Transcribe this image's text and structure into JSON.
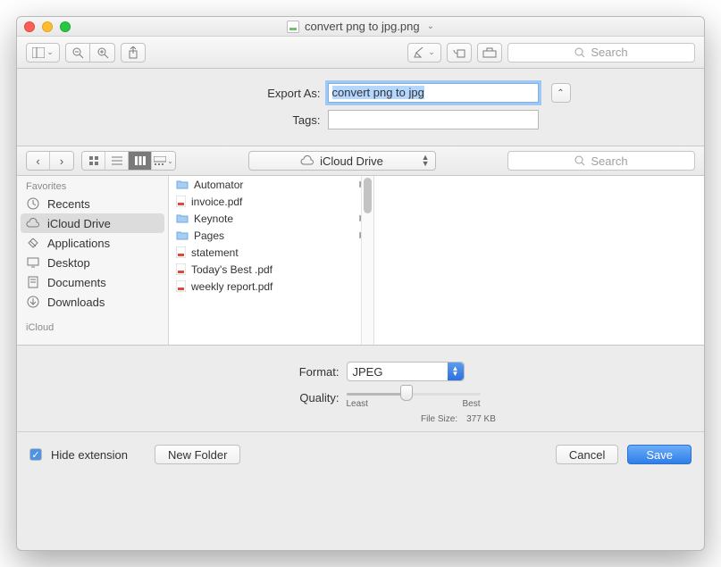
{
  "window": {
    "title": "convert png to jpg.png"
  },
  "toolbar": {
    "search_placeholder": "Search"
  },
  "export": {
    "export_as_label": "Export As:",
    "export_as_value": "convert png to jpg",
    "tags_label": "Tags:",
    "tags_value": ""
  },
  "browser": {
    "location": "iCloud Drive",
    "search_placeholder": "Search",
    "sidebar_header": "Favorites",
    "sidebar_secondary_header": "iCloud",
    "sidebar": [
      {
        "label": "Recents",
        "icon": "clock"
      },
      {
        "label": "iCloud Drive",
        "icon": "cloud",
        "selected": true
      },
      {
        "label": "Applications",
        "icon": "app"
      },
      {
        "label": "Desktop",
        "icon": "desktop"
      },
      {
        "label": "Documents",
        "icon": "doc"
      },
      {
        "label": "Downloads",
        "icon": "download"
      }
    ],
    "files": [
      {
        "name": "Automator",
        "kind": "folder",
        "has_children": true
      },
      {
        "name": "invoice.pdf",
        "kind": "pdf"
      },
      {
        "name": "Keynote",
        "kind": "folder",
        "has_children": true
      },
      {
        "name": "Pages",
        "kind": "folder",
        "has_children": true
      },
      {
        "name": "statement",
        "kind": "pdf"
      },
      {
        "name": "Today's Best .pdf",
        "kind": "pdf"
      },
      {
        "name": "weekly report.pdf",
        "kind": "pdf"
      }
    ]
  },
  "format": {
    "format_label": "Format:",
    "format_value": "JPEG",
    "quality_label": "Quality:",
    "quality_least": "Least",
    "quality_best": "Best",
    "filesize_label": "File Size:",
    "filesize_value": "377 KB"
  },
  "bottom": {
    "hide_ext_label": "Hide extension",
    "hide_ext_checked": true,
    "new_folder": "New Folder",
    "cancel": "Cancel",
    "save": "Save"
  }
}
